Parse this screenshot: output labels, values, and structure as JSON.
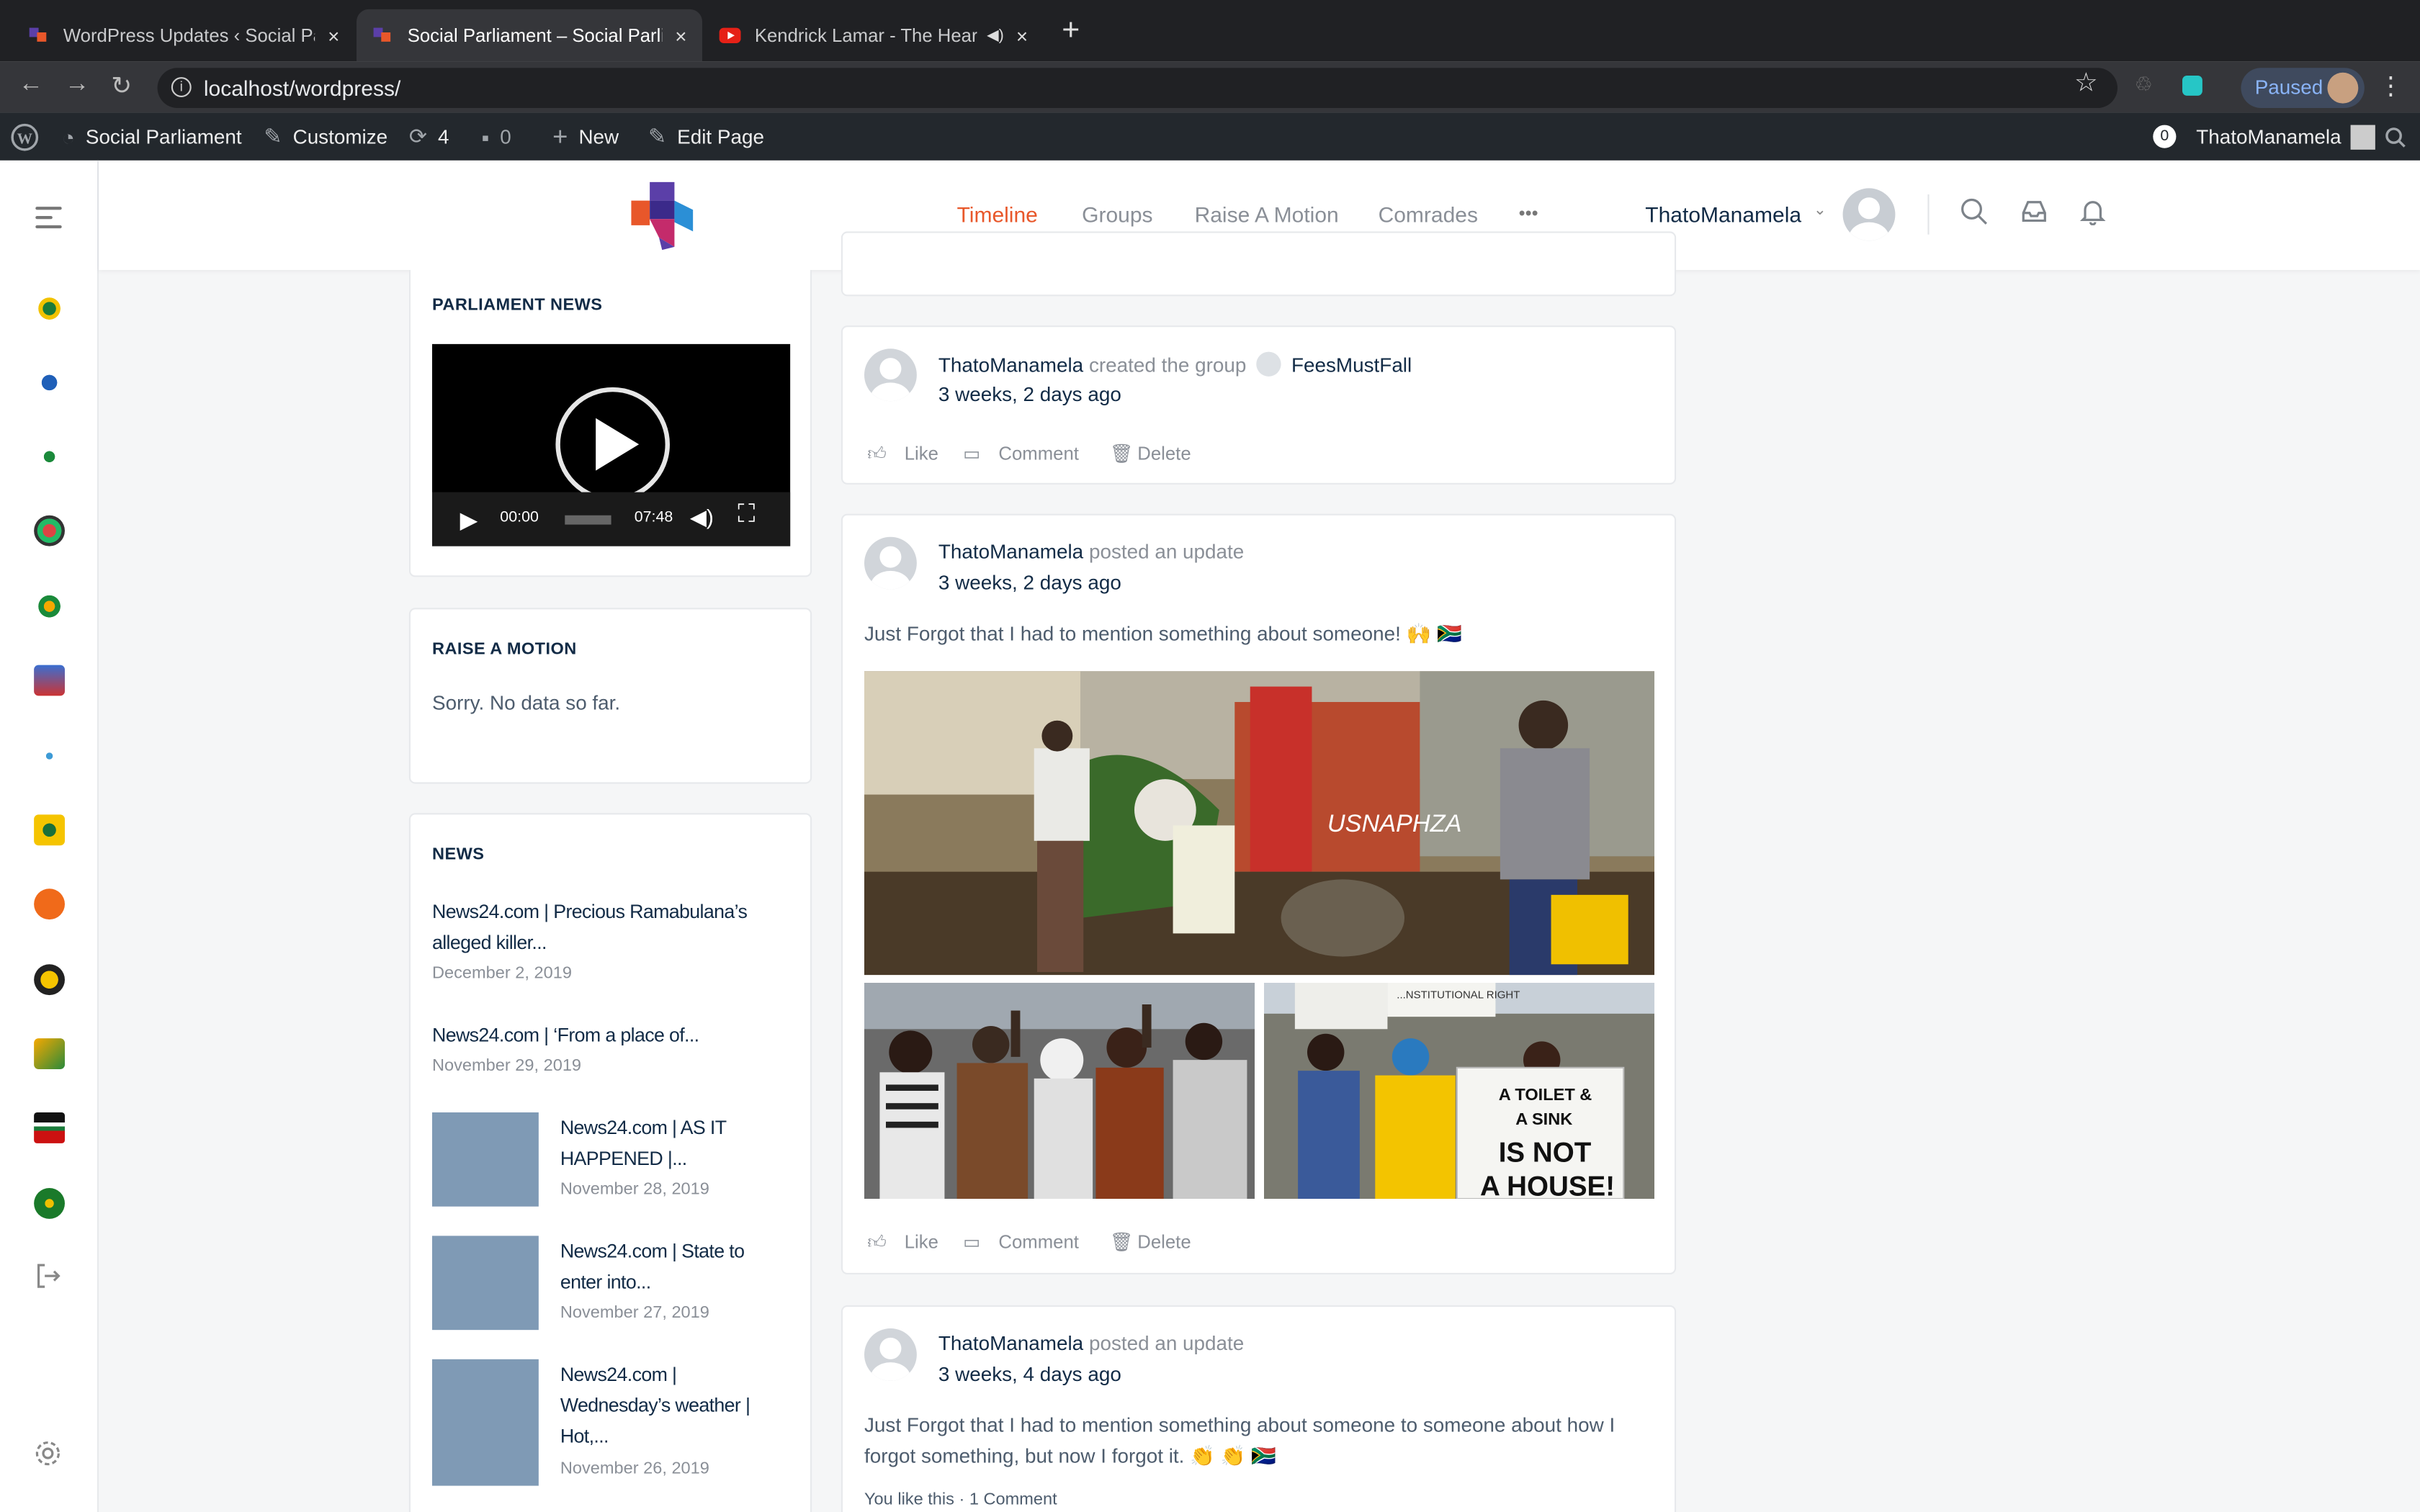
{
  "browser": {
    "tabs": [
      {
        "title": "WordPress Updates ‹ Social Parl",
        "close": "×"
      },
      {
        "title": "Social Parliament – Social Parliam",
        "close": "×"
      },
      {
        "title": "Kendrick Lamar - The Heart",
        "close": "×"
      }
    ],
    "new_tab": "+",
    "url": "localhost/wordpress/",
    "profile_status": "Paused"
  },
  "adminbar": {
    "site": "Social Parliament",
    "customize": "Customize",
    "updates": "4",
    "comments": "0",
    "new": "New",
    "edit": "Edit Page",
    "notif_count": "0",
    "user": "ThatoManamela"
  },
  "header": {
    "nav": [
      "Timeline",
      "Groups",
      "Raise A Motion",
      "Comrades"
    ],
    "more": "•••",
    "username": "ThatoManamela",
    "caret": "⌄"
  },
  "sidebar": {
    "parliament_news": {
      "title": "PARLIAMENT NEWS",
      "time_current": "00:00",
      "time_total": "07:48"
    },
    "raise_motion": {
      "title": "RAISE A MOTION",
      "empty": "Sorry. No data so far."
    },
    "news": {
      "title": "NEWS",
      "items": [
        {
          "title": "News24.com | Precious Ramabulana’s alleged killer...",
          "date": "December 2, 2019"
        },
        {
          "title": "News24.com | ‘From a place of...",
          "date": "November 29, 2019"
        },
        {
          "title": "News24.com | AS IT HAPPENED |...",
          "date": "November 28, 2019"
        },
        {
          "title": "News24.com | State to enter into...",
          "date": "November 27, 2019"
        },
        {
          "title": "News24.com | Wednesday’s weather | Hot,...",
          "date": "November 26, 2019"
        }
      ]
    }
  },
  "feed": {
    "actions": {
      "like": "Like",
      "comment": "Comment",
      "delete": "Delete"
    },
    "posts": [
      {
        "author": "ThatoManamela",
        "action": "created the group",
        "group": "FeesMustFall",
        "time": "3 weeks, 2 days ago"
      },
      {
        "author": "ThatoManamela",
        "action": "posted an update",
        "time": "3 weeks, 2 days ago",
        "text": "Just Forgot that I had to mention something about someone! 🙌 🇿🇦"
      },
      {
        "author": "ThatoManamela",
        "action": "posted an update",
        "time": "3 weeks, 4 days ago",
        "text": "Just Forgot that I had to mention something about someone to someone about how I forgot something, but now I forgot it. 👏 👏 🇿🇦",
        "likes": "You like this · 1 Comment"
      }
    ]
  },
  "photo_text": {
    "wall": "USNAPHZA",
    "sign1": "A TOILET &",
    "sign2": "A SINK",
    "sign3": "IS NOT",
    "sign4": "A HOUSE!",
    "banner": "...NSTITUTIONAL RIGHT"
  },
  "colors": {
    "accent": "#e8572a",
    "admin_bar": "#23282d",
    "navy": "#122b46"
  }
}
